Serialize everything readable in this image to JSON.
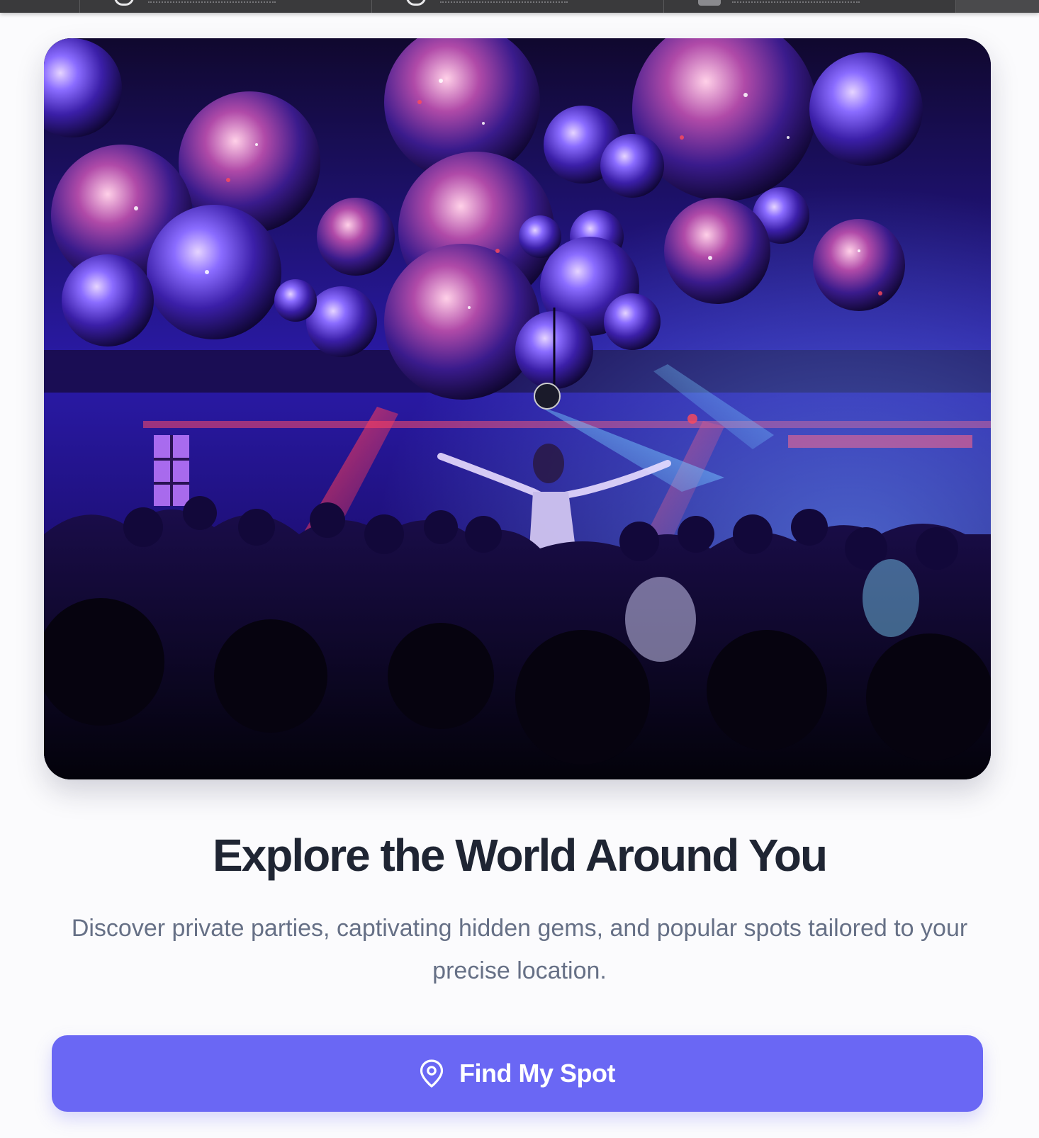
{
  "hero": {
    "image_alt": "Nightclub dance floor with disco balls and crowd"
  },
  "content": {
    "title": "Explore the World Around You",
    "subtitle": "Discover private parties, captivating hidden gems, and popular spots tailored to your precise location."
  },
  "cta": {
    "label": "Find My Spot",
    "icon": "map-pin-icon"
  },
  "colors": {
    "accent": "#6a67f4",
    "title": "#1f2533",
    "subtitle": "#667086",
    "background": "#fbfbfd"
  }
}
